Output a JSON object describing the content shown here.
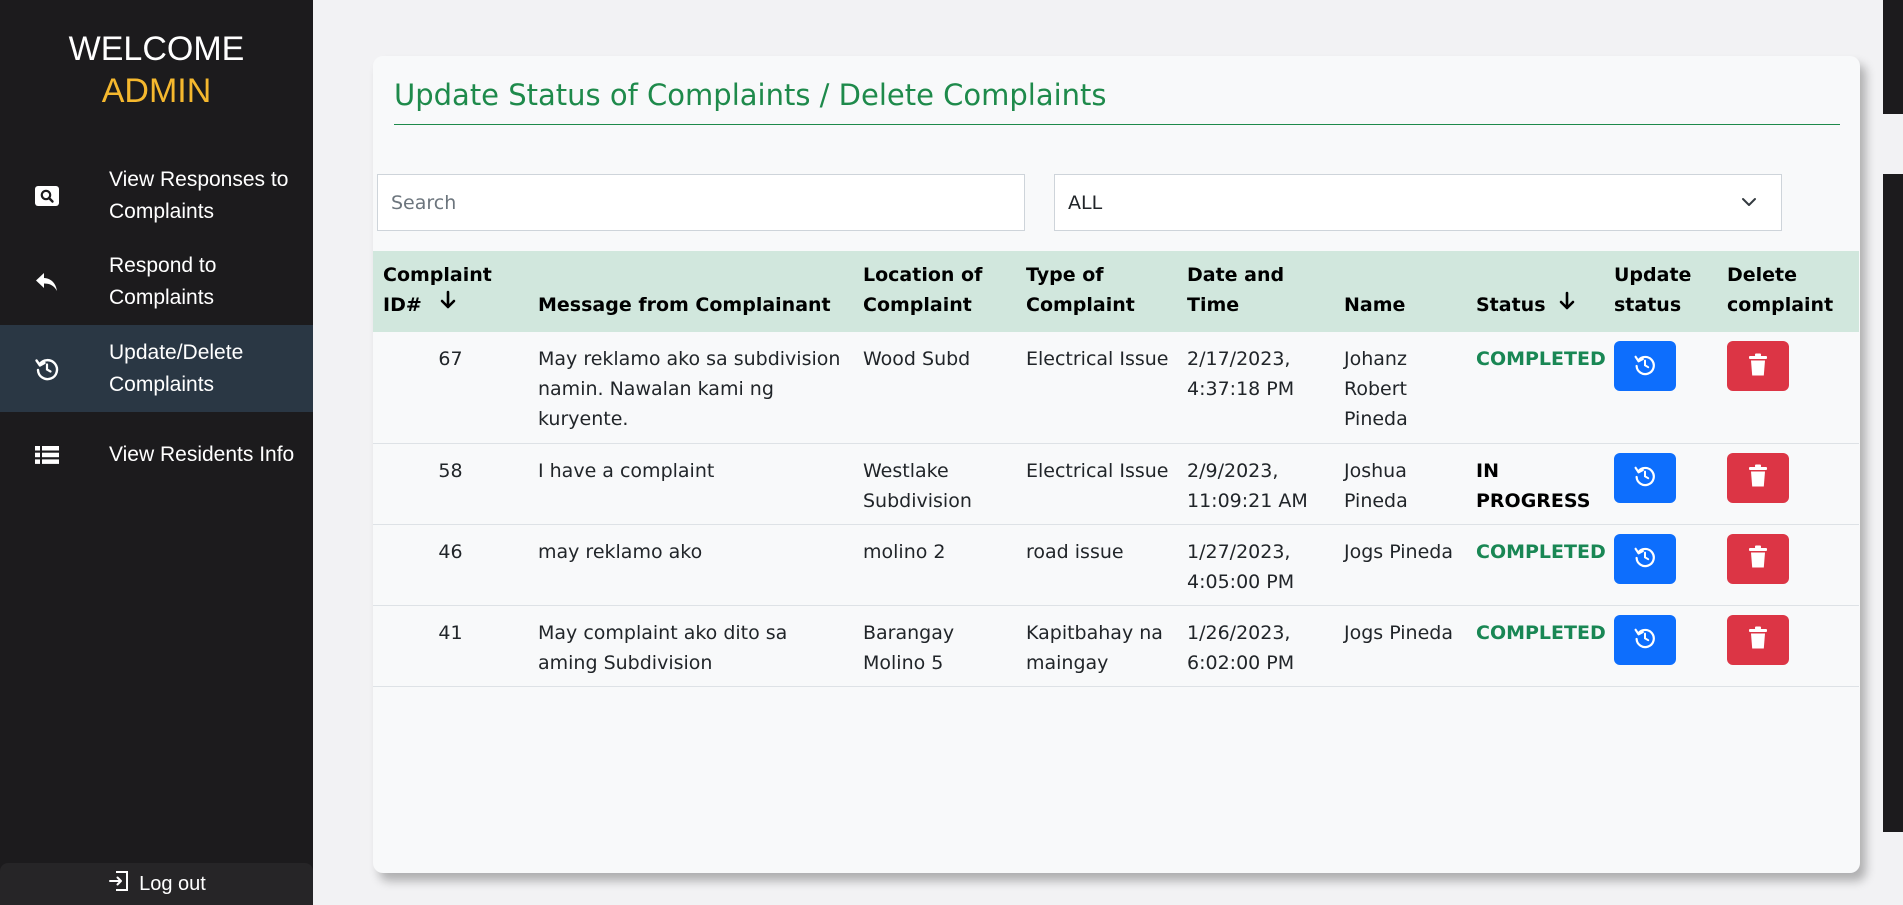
{
  "sidebar": {
    "welcome_line1": "WELCOME",
    "welcome_line2": "ADMIN",
    "items": [
      {
        "label": "View Responses to Complaints",
        "icon": "search-icon"
      },
      {
        "label": "Respond to Complaints",
        "icon": "reply-icon"
      },
      {
        "label": "Update/Delete Complaints",
        "icon": "history-icon"
      },
      {
        "label": "View Residents Info",
        "icon": "list-icon"
      }
    ],
    "logout_label": "Log out"
  },
  "main": {
    "title": "Update Status of Complaints / Delete Complaints",
    "search_placeholder": "Search",
    "filter_value": "ALL",
    "columns": {
      "id": "Complaint ID#",
      "message": "Message from Complainant",
      "location": "Location of Complaint",
      "type": "Type of Complaint",
      "datetime": "Date and Time",
      "name": "Name",
      "status": "Status",
      "update": "Update status",
      "delete": "Delete complaint"
    },
    "rows": [
      {
        "id": "67",
        "message": "May reklamo ako sa subdivision namin. Nawalan kami ng kuryente.",
        "location": "Wood Subd",
        "type": "Electrical Issue",
        "datetime": "2/17/2023, 4:37:18 PM",
        "name": "Johanz Robert Pineda",
        "status": "COMPLETED",
        "status_kind": "completed"
      },
      {
        "id": "58",
        "message": "I have a complaint",
        "location": "Westlake Subdivision",
        "type": "Electrical Issue",
        "datetime": "2/9/2023, 11:09:21 AM",
        "name": "Joshua Pineda",
        "status": "IN PROGRESS",
        "status_kind": "progress"
      },
      {
        "id": "46",
        "message": "may reklamo ako",
        "location": "molino 2",
        "type": "road issue",
        "datetime": "1/27/2023, 4:05:00 PM",
        "name": "Jogs Pineda",
        "status": "COMPLETED",
        "status_kind": "completed"
      },
      {
        "id": "41",
        "message": "May complaint ako dito sa aming Subdivision",
        "location": "Barangay Molino 5",
        "type": "Kapitbahay na maingay",
        "datetime": "1/26/2023, 6:02:00 PM",
        "name": "Jogs Pineda",
        "status": "COMPLETED",
        "status_kind": "completed"
      }
    ]
  },
  "colors": {
    "sidebar_bg": "#1c1b1d",
    "admin_accent": "#f5b82e",
    "title_green": "#1e8a4b",
    "header_bg": "#d1e7dd",
    "completed": "#198754",
    "update_button": "#0d6efd",
    "delete_button": "#dc3545"
  }
}
